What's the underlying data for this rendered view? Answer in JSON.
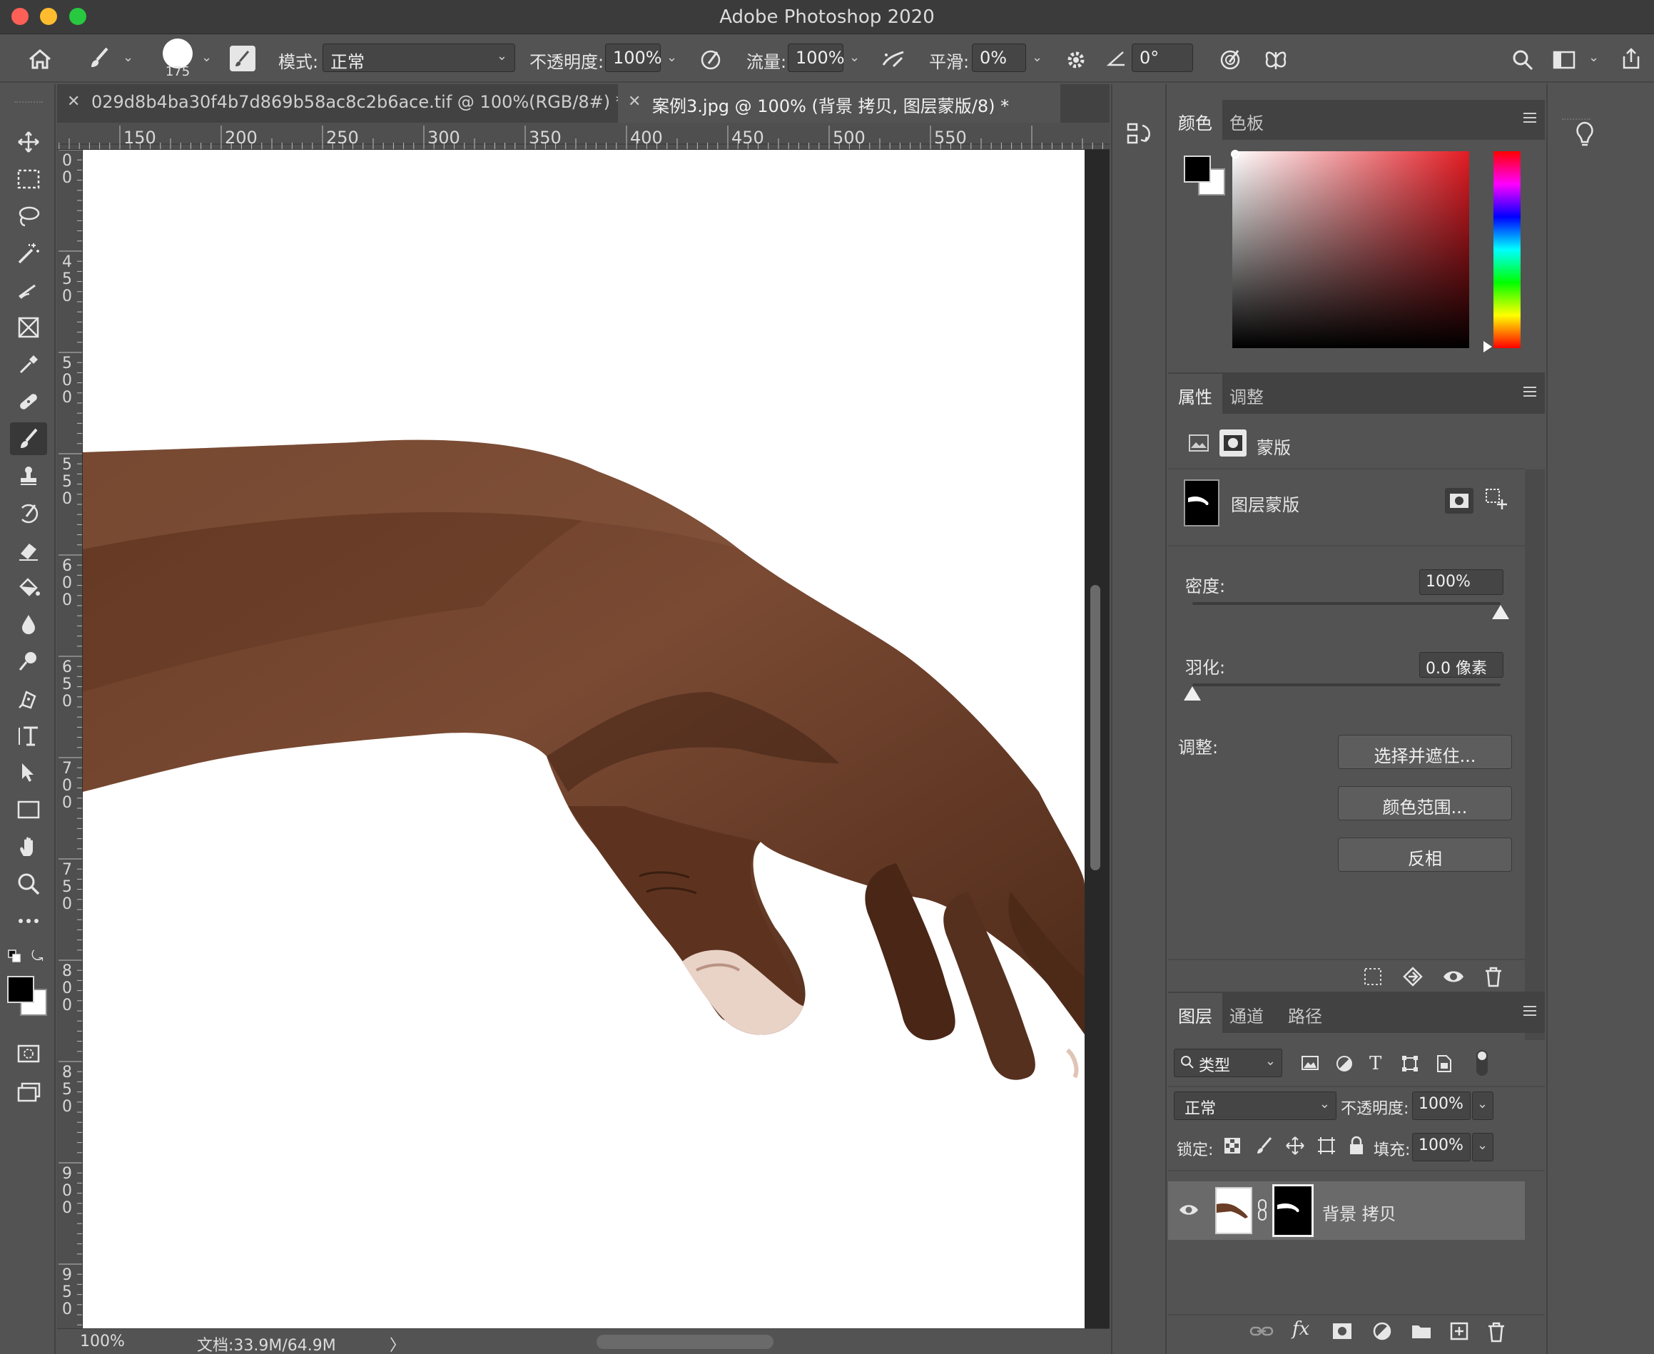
{
  "app": {
    "title": "Adobe Photoshop 2020"
  },
  "options": {
    "brush_size": "175",
    "mode_label": "模式:",
    "mode_value": "正常",
    "opacity_label": "不透明度:",
    "opacity_value": "100%",
    "flow_label": "流量:",
    "flow_value": "100%",
    "smooth_label": "平滑:",
    "smooth_value": "0%",
    "angle_value": "0°"
  },
  "tabs": [
    {
      "label": "029d8b4ba30f4b7d869b58ac8c2b6ace.tif @ 100%(RGB/8#) *"
    },
    {
      "label": "案例3.jpg @ 100% (背景 拷贝, 图层蒙版/8) *"
    }
  ],
  "ruler": {
    "h": [
      "150",
      "200",
      "250",
      "300",
      "350",
      "400",
      "450",
      "500",
      "550"
    ],
    "v": [
      "00",
      "450",
      "500",
      "550",
      "600",
      "650",
      "700",
      "750",
      "800",
      "850",
      "900",
      "950"
    ]
  },
  "status": {
    "zoom": "100%",
    "doc": "文档:33.9M/64.9M",
    "arrow": "〉"
  },
  "color_panel": {
    "tabs": [
      "颜色",
      "色板"
    ]
  },
  "properties": {
    "tabs": [
      "属性",
      "调整"
    ],
    "mask_type": "蒙版",
    "layer_mask_label": "图层蒙版",
    "density_label": "密度:",
    "density_value": "100%",
    "density_fraction": 1.0,
    "feather_label": "羽化:",
    "feather_value": "0.0 像素",
    "feather_fraction": 0.0,
    "adjust_label": "调整:",
    "btn_select_mask": "选择并遮住...",
    "btn_color_range": "颜色范围...",
    "btn_invert": "反相"
  },
  "layers": {
    "tabs": [
      "图层",
      "通道",
      "路径"
    ],
    "filter_label": "类型",
    "blend_value": "正常",
    "opacity_label": "不透明度:",
    "opacity_value": "100%",
    "lock_label": "锁定:",
    "fill_label": "填充:",
    "fill_value": "100%",
    "items": [
      {
        "name": "背景 拷贝"
      }
    ]
  },
  "colors": {
    "accent": "#e31b23",
    "bg": "#535353",
    "panel_dark": "#424242"
  }
}
